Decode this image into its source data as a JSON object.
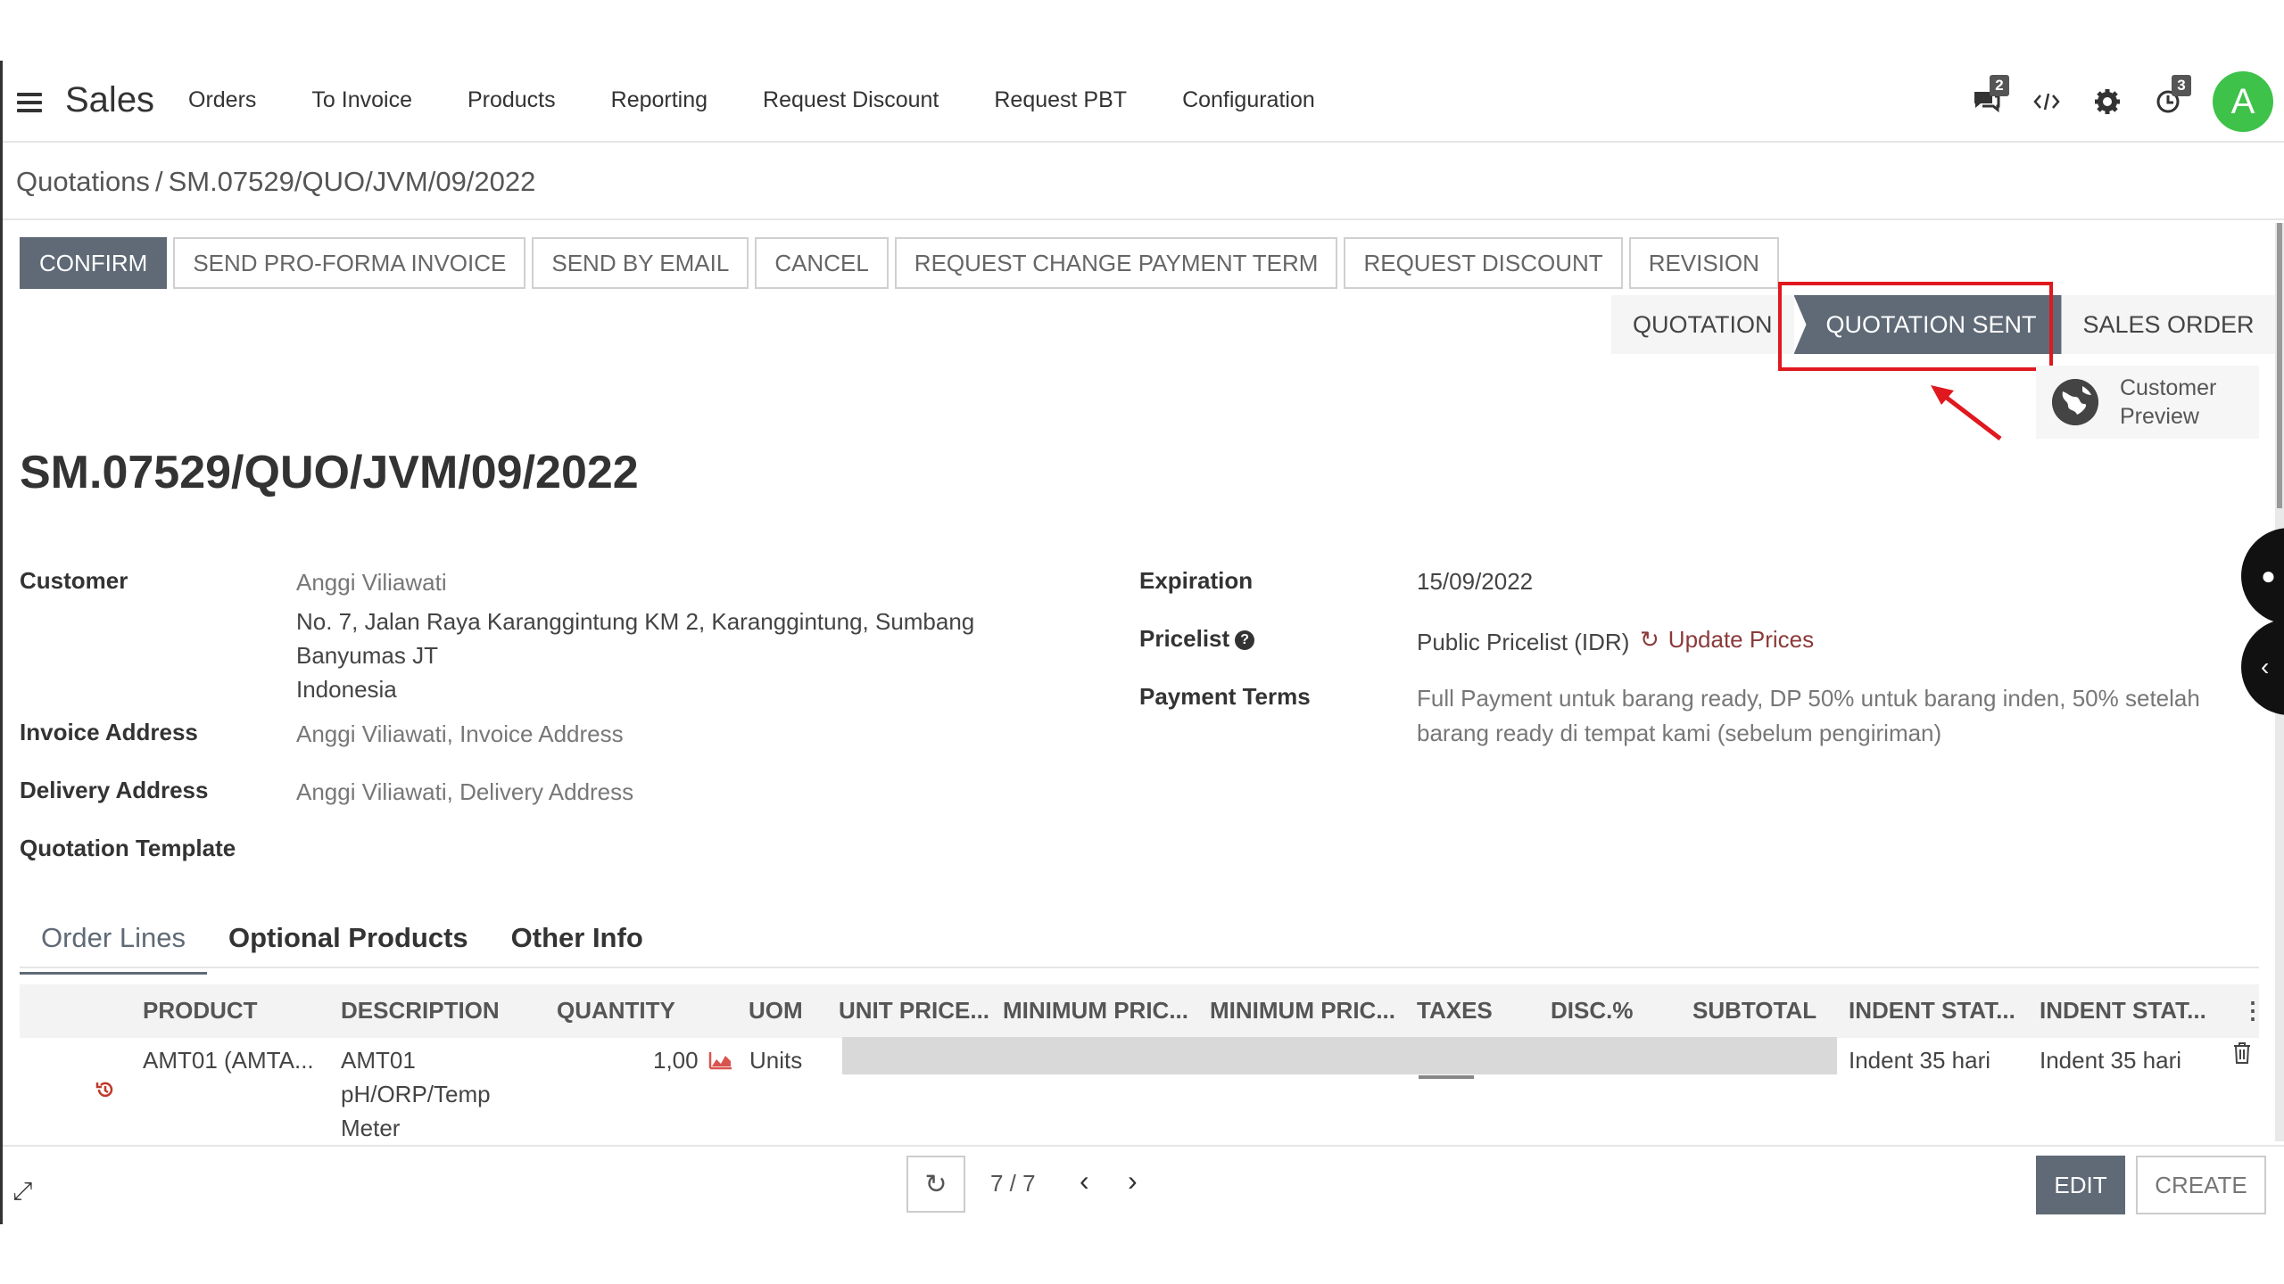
{
  "navbar": {
    "app_title": "Sales",
    "menu": [
      "Orders",
      "To Invoice",
      "Products",
      "Reporting",
      "Request Discount",
      "Request PBT",
      "Configuration"
    ],
    "messages_badge": "2",
    "activities_badge": "3",
    "avatar_letter": "A"
  },
  "breadcrumb": {
    "parent": "Quotations",
    "current": "SM.07529/QUO/JVM/09/2022"
  },
  "actions": [
    "CONFIRM",
    "SEND PRO-FORMA INVOICE",
    "SEND BY EMAIL",
    "CANCEL",
    "REQUEST CHANGE PAYMENT TERM",
    "REQUEST DISCOUNT",
    "REVISION"
  ],
  "status": {
    "stages": [
      "QUOTATION",
      "QUOTATION SENT",
      "SALES ORDER"
    ],
    "active": "QUOTATION SENT"
  },
  "customer_preview": "Customer Preview",
  "title": "SM.07529/QUO/JVM/09/2022",
  "fields": {
    "customer_label": "Customer",
    "customer_name": "Anggi Viliawati",
    "address_line1": "No. 7, Jalan Raya Karanggintung KM 2, Karanggintung, Sumbang",
    "address_line2": "Banyumas JT",
    "address_line3": "Indonesia",
    "invoice_label": "Invoice Address",
    "invoice_value": "Anggi Viliawati, Invoice Address",
    "delivery_label": "Delivery Address",
    "delivery_value": "Anggi Viliawati, Delivery Address",
    "template_label": "Quotation Template",
    "expiration_label": "Expiration",
    "expiration_value": "15/09/2022",
    "pricelist_label": "Pricelist",
    "pricelist_value": "Public Pricelist (IDR)",
    "update_prices": "Update Prices",
    "payment_label": "Payment Terms",
    "payment_line1": "Full Payment untuk barang ready, DP 50% untuk barang inden, 50% setelah",
    "payment_line2": "barang ready di tempat kami (sebelum pengiriman)"
  },
  "tabs": [
    "Order Lines",
    "Optional Products",
    "Other Info"
  ],
  "table": {
    "headers": [
      "PRODUCT",
      "DESCRIPTION",
      "QUANTITY",
      "UOM",
      "UNIT PRICE...",
      "MINIMUM PRIC...",
      "MINIMUM PRIC...",
      "TAXES",
      "DISC.%",
      "SUBTOTAL",
      "INDENT STAT...",
      "INDENT STAT..."
    ],
    "row": {
      "product": "AMT01 (AMTA...",
      "description_lines": [
        "AMT01",
        "pH/ORP/Temp",
        "Meter"
      ],
      "quantity": "1,00",
      "uom": "Units",
      "indent1": "Indent 35 hari",
      "indent2": "Indent 35 hari"
    }
  },
  "pager": {
    "text": "7 / 7"
  },
  "bottom": {
    "edit": "EDIT",
    "create": "CREATE"
  },
  "colors": {
    "primary": "#5f6a76",
    "highlight": "#e0181f",
    "avatar": "#3ec24a"
  }
}
